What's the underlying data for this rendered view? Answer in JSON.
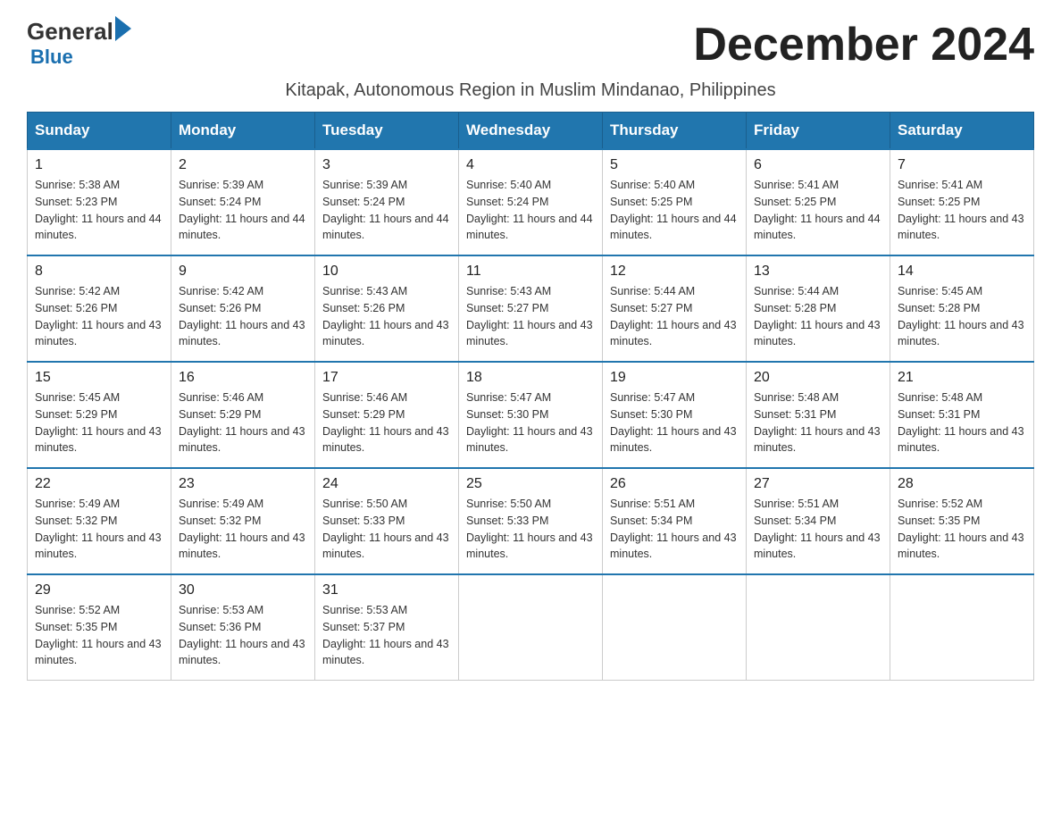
{
  "logo": {
    "general": "General",
    "blue": "Blue"
  },
  "title": "December 2024",
  "subtitle": "Kitapak, Autonomous Region in Muslim Mindanao, Philippines",
  "days_of_week": [
    "Sunday",
    "Monday",
    "Tuesday",
    "Wednesday",
    "Thursday",
    "Friday",
    "Saturday"
  ],
  "weeks": [
    [
      {
        "day": "1",
        "sunrise": "5:38 AM",
        "sunset": "5:23 PM",
        "daylight": "11 hours and 44 minutes."
      },
      {
        "day": "2",
        "sunrise": "5:39 AM",
        "sunset": "5:24 PM",
        "daylight": "11 hours and 44 minutes."
      },
      {
        "day": "3",
        "sunrise": "5:39 AM",
        "sunset": "5:24 PM",
        "daylight": "11 hours and 44 minutes."
      },
      {
        "day": "4",
        "sunrise": "5:40 AM",
        "sunset": "5:24 PM",
        "daylight": "11 hours and 44 minutes."
      },
      {
        "day": "5",
        "sunrise": "5:40 AM",
        "sunset": "5:25 PM",
        "daylight": "11 hours and 44 minutes."
      },
      {
        "day": "6",
        "sunrise": "5:41 AM",
        "sunset": "5:25 PM",
        "daylight": "11 hours and 44 minutes."
      },
      {
        "day": "7",
        "sunrise": "5:41 AM",
        "sunset": "5:25 PM",
        "daylight": "11 hours and 43 minutes."
      }
    ],
    [
      {
        "day": "8",
        "sunrise": "5:42 AM",
        "sunset": "5:26 PM",
        "daylight": "11 hours and 43 minutes."
      },
      {
        "day": "9",
        "sunrise": "5:42 AM",
        "sunset": "5:26 PM",
        "daylight": "11 hours and 43 minutes."
      },
      {
        "day": "10",
        "sunrise": "5:43 AM",
        "sunset": "5:26 PM",
        "daylight": "11 hours and 43 minutes."
      },
      {
        "day": "11",
        "sunrise": "5:43 AM",
        "sunset": "5:27 PM",
        "daylight": "11 hours and 43 minutes."
      },
      {
        "day": "12",
        "sunrise": "5:44 AM",
        "sunset": "5:27 PM",
        "daylight": "11 hours and 43 minutes."
      },
      {
        "day": "13",
        "sunrise": "5:44 AM",
        "sunset": "5:28 PM",
        "daylight": "11 hours and 43 minutes."
      },
      {
        "day": "14",
        "sunrise": "5:45 AM",
        "sunset": "5:28 PM",
        "daylight": "11 hours and 43 minutes."
      }
    ],
    [
      {
        "day": "15",
        "sunrise": "5:45 AM",
        "sunset": "5:29 PM",
        "daylight": "11 hours and 43 minutes."
      },
      {
        "day": "16",
        "sunrise": "5:46 AM",
        "sunset": "5:29 PM",
        "daylight": "11 hours and 43 minutes."
      },
      {
        "day": "17",
        "sunrise": "5:46 AM",
        "sunset": "5:29 PM",
        "daylight": "11 hours and 43 minutes."
      },
      {
        "day": "18",
        "sunrise": "5:47 AM",
        "sunset": "5:30 PM",
        "daylight": "11 hours and 43 minutes."
      },
      {
        "day": "19",
        "sunrise": "5:47 AM",
        "sunset": "5:30 PM",
        "daylight": "11 hours and 43 minutes."
      },
      {
        "day": "20",
        "sunrise": "5:48 AM",
        "sunset": "5:31 PM",
        "daylight": "11 hours and 43 minutes."
      },
      {
        "day": "21",
        "sunrise": "5:48 AM",
        "sunset": "5:31 PM",
        "daylight": "11 hours and 43 minutes."
      }
    ],
    [
      {
        "day": "22",
        "sunrise": "5:49 AM",
        "sunset": "5:32 PM",
        "daylight": "11 hours and 43 minutes."
      },
      {
        "day": "23",
        "sunrise": "5:49 AM",
        "sunset": "5:32 PM",
        "daylight": "11 hours and 43 minutes."
      },
      {
        "day": "24",
        "sunrise": "5:50 AM",
        "sunset": "5:33 PM",
        "daylight": "11 hours and 43 minutes."
      },
      {
        "day": "25",
        "sunrise": "5:50 AM",
        "sunset": "5:33 PM",
        "daylight": "11 hours and 43 minutes."
      },
      {
        "day": "26",
        "sunrise": "5:51 AM",
        "sunset": "5:34 PM",
        "daylight": "11 hours and 43 minutes."
      },
      {
        "day": "27",
        "sunrise": "5:51 AM",
        "sunset": "5:34 PM",
        "daylight": "11 hours and 43 minutes."
      },
      {
        "day": "28",
        "sunrise": "5:52 AM",
        "sunset": "5:35 PM",
        "daylight": "11 hours and 43 minutes."
      }
    ],
    [
      {
        "day": "29",
        "sunrise": "5:52 AM",
        "sunset": "5:35 PM",
        "daylight": "11 hours and 43 minutes."
      },
      {
        "day": "30",
        "sunrise": "5:53 AM",
        "sunset": "5:36 PM",
        "daylight": "11 hours and 43 minutes."
      },
      {
        "day": "31",
        "sunrise": "5:53 AM",
        "sunset": "5:37 PM",
        "daylight": "11 hours and 43 minutes."
      },
      null,
      null,
      null,
      null
    ]
  ]
}
